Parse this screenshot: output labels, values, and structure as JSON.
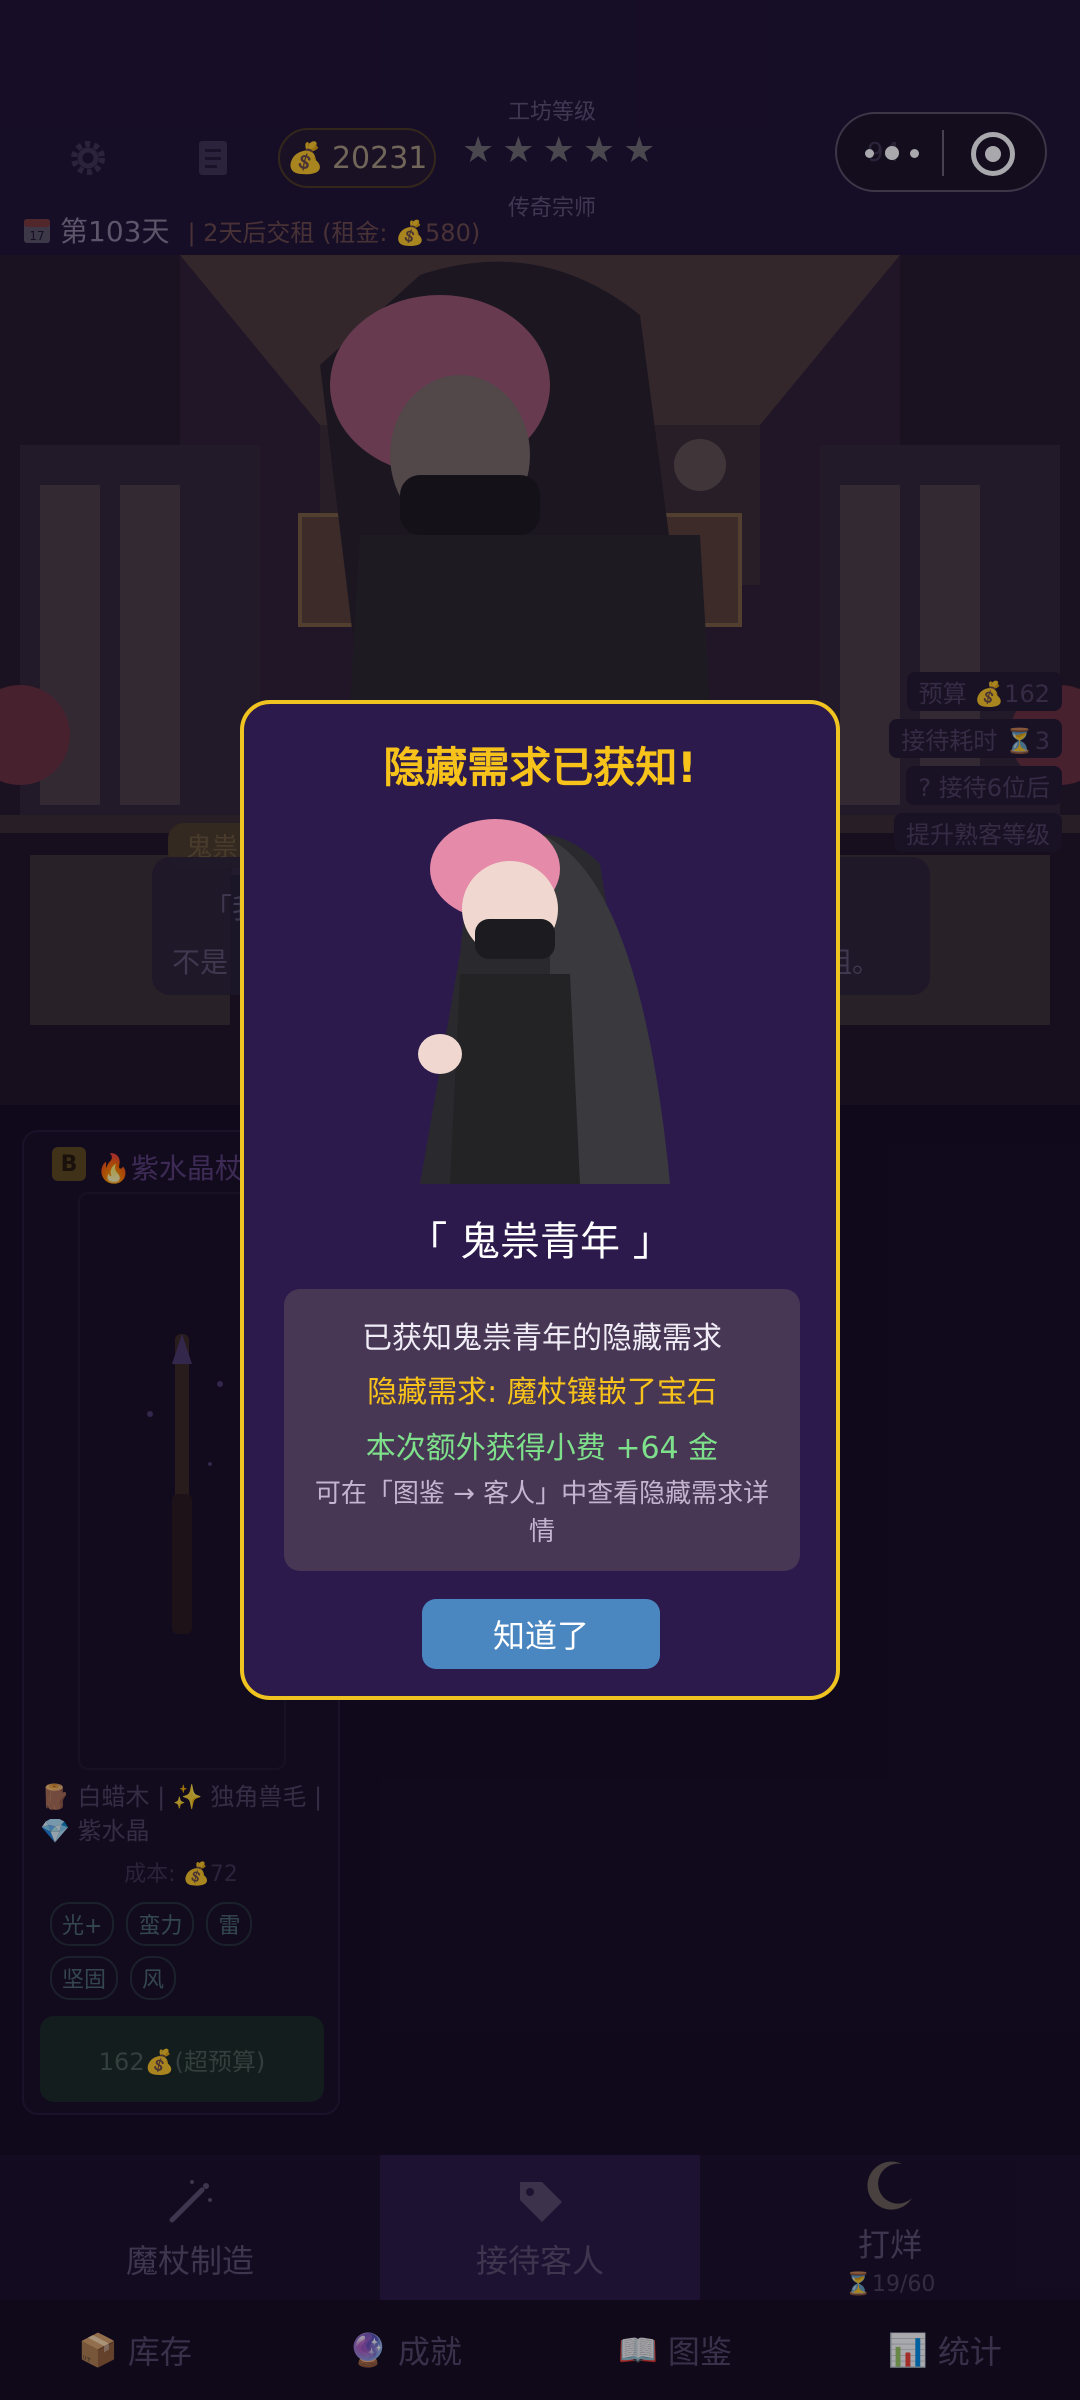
{
  "header": {
    "coins": "20231",
    "level_title": "工坊等级",
    "stars": [
      "★",
      "★",
      "★",
      "★",
      "★"
    ],
    "level_name": "传奇宗师",
    "day": "第103天",
    "rent_notice": "| 2天后交租 (租金: 💰580)",
    "calendar_day": "17",
    "capsule_faint": "94"
  },
  "scene": {
    "info": [
      "预算 💰162",
      "接待耗时 ⏳3",
      "? 接待6位后",
      "提升熟客等级"
    ],
    "speaker_tag": "鬼祟",
    "dialogue_a": "「我",
    "dialogue_b": "不是",
    "dialogue_c": "粗。"
  },
  "wand_card": {
    "grade": "B",
    "name": "🔥紫水晶杖",
    "materials": "🪵 白蜡木 | ✨ 独角兽毛 | 💎 紫水晶",
    "cost": "成本: 💰72",
    "tags": [
      "光+",
      "蛮力",
      "雷",
      "坚固",
      "风"
    ],
    "price_label": "162💰(超预算)"
  },
  "nav": {
    "make_wand": "魔杖制造",
    "receive": "接待客人",
    "close_shop": "打烊",
    "time": "⏳19/60"
  },
  "tabs": [
    {
      "icon": "📦",
      "label": "库存"
    },
    {
      "icon": "🔮",
      "label": "成就"
    },
    {
      "icon": "📖",
      "label": "图鉴"
    },
    {
      "icon": "📊",
      "label": "统计"
    }
  ],
  "modal": {
    "title": "隐藏需求已获知!",
    "customer_name": "「 鬼祟青年 」",
    "line1": "已获知鬼祟青年的隐藏需求",
    "line2": "隐藏需求: 魔杖镶嵌了宝石",
    "line3": "本次额外获得小费 +64 金",
    "line4": "可在「图鉴 → 客人」中查看隐藏需求详情",
    "ok_label": "知道了"
  },
  "colors": {
    "accent_gold": "#f7c31a",
    "modal_bg": "#2c1a4c",
    "tip_green": "#7ee08a",
    "button_blue": "#4a86c0"
  }
}
